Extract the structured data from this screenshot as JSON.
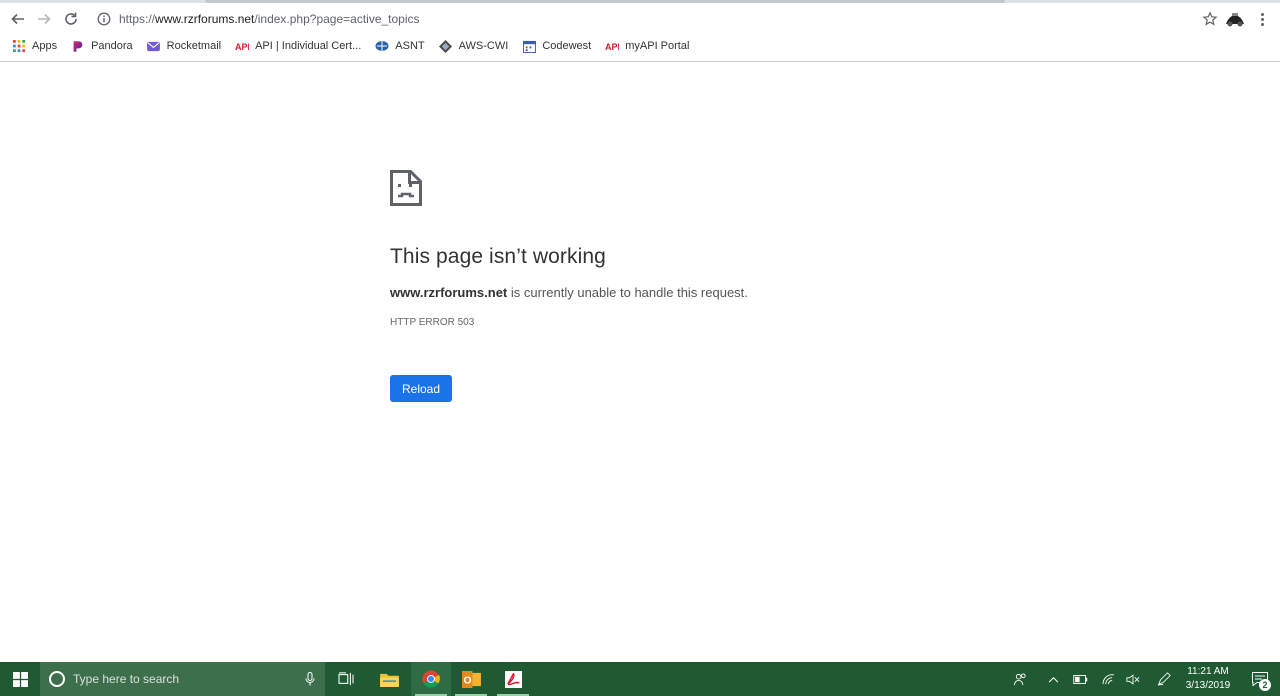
{
  "browser": {
    "url_prefix": "https://",
    "url_host": "www.rzrforums.net",
    "url_path": "/index.php?page=active_topics"
  },
  "bookmarks": [
    {
      "label": "Apps",
      "icon": "apps-grid-icon"
    },
    {
      "label": "Pandora",
      "icon": "pandora-icon"
    },
    {
      "label": "Rocketmail",
      "icon": "mail-icon"
    },
    {
      "label": "API | Individual Cert...",
      "icon": "api-logo-icon"
    },
    {
      "label": "ASNT",
      "icon": "asnt-logo-icon"
    },
    {
      "label": "AWS-CWI",
      "icon": "aws-logo-icon"
    },
    {
      "label": "Codewest",
      "icon": "calendar-icon"
    },
    {
      "label": "myAPI Portal",
      "icon": "api-logo-icon"
    }
  ],
  "error": {
    "title": "This page isn’t working",
    "host": "www.rzrforums.net",
    "message": " is currently unable to handle this request.",
    "code": "HTTP ERROR 503",
    "reload_label": "Reload"
  },
  "taskbar": {
    "search_placeholder": "Type here to search",
    "time": "11:21 AM",
    "date": "3/13/2019",
    "notification_count": "2",
    "colors": {
      "background": "#1f5a32",
      "search": "#3e6f4d"
    }
  },
  "colors": {
    "accent": "#1a73e8"
  }
}
